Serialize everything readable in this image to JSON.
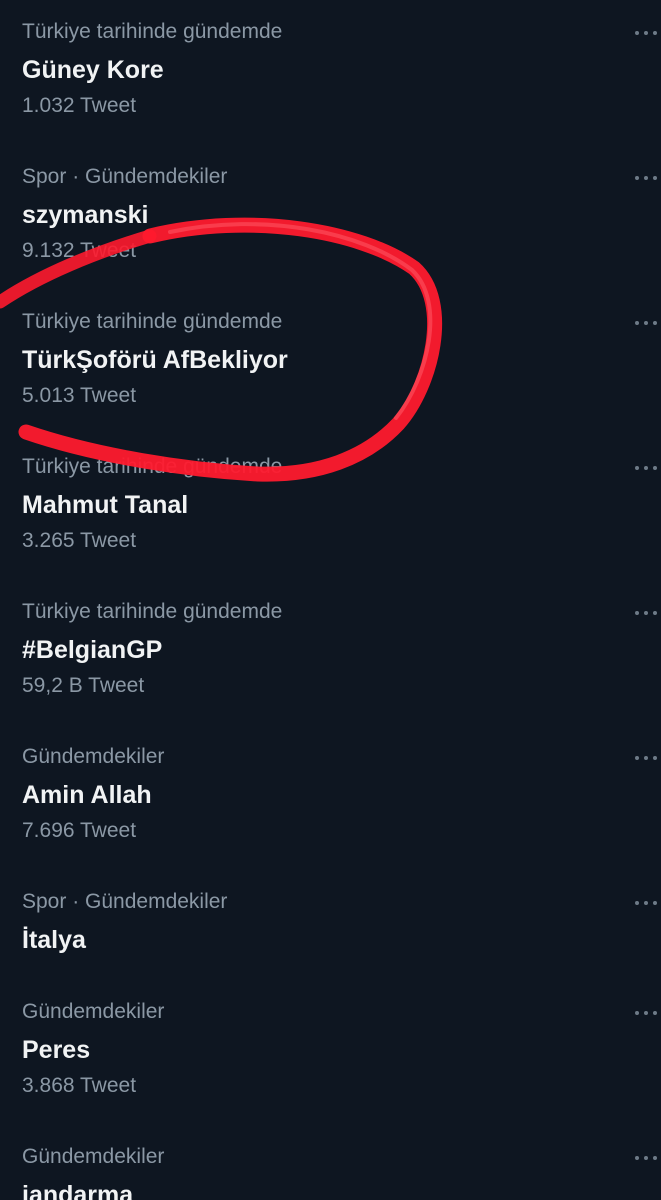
{
  "colors": {
    "background": "#0e1621",
    "primary_text": "#f1f3f4",
    "secondary_text": "#8b98a5",
    "annotation_stroke": "#ff1a2e"
  },
  "trends": [
    {
      "context": "Türkiye tarihinde gündemde",
      "name": "Güney Kore",
      "count": "1.032 Tweet"
    },
    {
      "context": "Spor · Gündemdekiler",
      "name": "szymanski",
      "count": "9.132 Tweet"
    },
    {
      "context": "Türkiye tarihinde gündemde",
      "name": "TürkŞoförü AfBekliyor",
      "count": "5.013 Tweet"
    },
    {
      "context": "Türkiye tarihinde gündemde",
      "name": "Mahmut Tanal",
      "count": "3.265 Tweet"
    },
    {
      "context": "Türkiye tarihinde gündemde",
      "name": "#BelgianGP",
      "count": "59,2 B Tweet"
    },
    {
      "context": "Gündemdekiler",
      "name": "Amin Allah",
      "count": "7.696 Tweet"
    },
    {
      "context": "Spor · Gündemdekiler",
      "name": "İtalya"
    },
    {
      "context": "Gündemdekiler",
      "name": "Peres",
      "count": "3.868 Tweet"
    },
    {
      "context": "Gündemdekiler",
      "name": "jandarma"
    }
  ],
  "icons": {
    "more": "more-options-icon"
  }
}
